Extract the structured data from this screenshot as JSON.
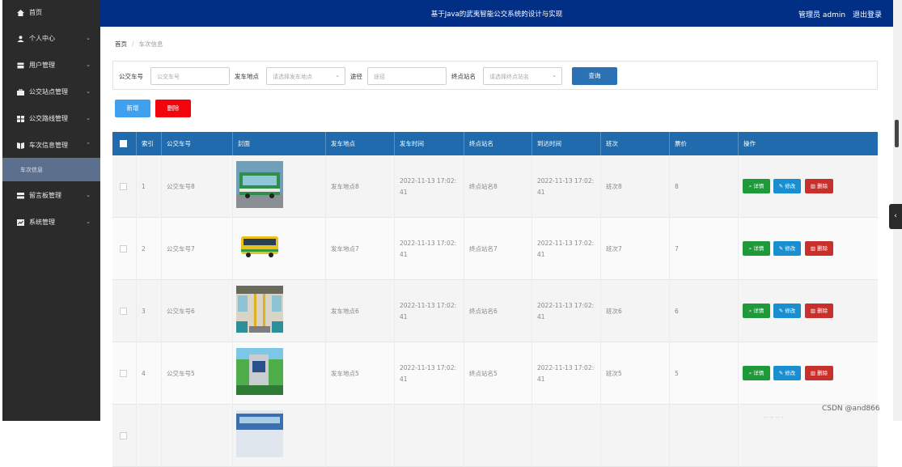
{
  "sidebar": {
    "items": [
      {
        "label": "首页",
        "icon": "home-icon",
        "has_chevron": false
      },
      {
        "label": "个人中心",
        "icon": "user-icon",
        "has_chevron": true,
        "chevron": "⌄"
      },
      {
        "label": "用户管理",
        "icon": "user-card-icon",
        "has_chevron": true,
        "chevron": "⌄"
      },
      {
        "label": "公交站点管理",
        "icon": "briefcase-icon",
        "has_chevron": true,
        "chevron": "⌄"
      },
      {
        "label": "公交路线管理",
        "icon": "grid-icon",
        "has_chevron": true,
        "chevron": "⌄"
      },
      {
        "label": "车次信息管理",
        "icon": "bookmark-icon",
        "has_chevron": true,
        "chevron": "⌃"
      },
      {
        "label": "留言板管理",
        "icon": "message-icon",
        "has_chevron": true,
        "chevron": "⌄"
      },
      {
        "label": "系统管理",
        "icon": "settings-icon",
        "has_chevron": true,
        "chevron": "⌄"
      }
    ],
    "active_sub": "车次信息"
  },
  "header": {
    "title": "基于Java的武夷智能公交系统的设计与实现",
    "user": "管理员 admin",
    "logout": "退出登录"
  },
  "breadcrumb": {
    "home": "首页",
    "current": "车次信息"
  },
  "search": {
    "fields": [
      {
        "label": "公交车号",
        "placeholder": "公交车号",
        "dropdown": false
      },
      {
        "label": "发车地点",
        "placeholder": "请选择发车地点",
        "dropdown": true
      },
      {
        "label": "途径",
        "placeholder": "途径",
        "dropdown": false
      },
      {
        "label": "终点站名",
        "placeholder": "请选择终点站名",
        "dropdown": true
      }
    ],
    "query_label": "查询"
  },
  "toolbar": {
    "add_label": "新增",
    "delete_label": "删除"
  },
  "table": {
    "headers": [
      "索引",
      "公交车号",
      "封面",
      "发车地点",
      "发车时间",
      "终点站名",
      "到达时间",
      "班次",
      "票价",
      "操作"
    ],
    "rows": [
      {
        "index": "1",
        "bus_no": "公交车号8",
        "cover": "green-bus-photo",
        "origin": "发车地点8",
        "depart_a": "2022-11-13 17:02:",
        "depart_b": "41",
        "terminal": "终点站名8",
        "arrive_a": "2022-11-13 17:02:",
        "arrive_b": "41",
        "shift": "班次8",
        "price": "8"
      },
      {
        "index": "2",
        "bus_no": "公交车号7",
        "cover": "yellow-bus-photo",
        "origin": "发车地点7",
        "depart_a": "2022-11-13 17:02:",
        "depart_b": "41",
        "terminal": "终点站名7",
        "arrive_a": "2022-11-13 17:02:",
        "arrive_b": "41",
        "shift": "班次7",
        "price": "7"
      },
      {
        "index": "3",
        "bus_no": "公交车号6",
        "cover": "bus-interior-photo",
        "origin": "发车地点6",
        "depart_a": "2022-11-13 17:02:",
        "depart_b": "41",
        "terminal": "终点站名6",
        "arrive_a": "2022-11-13 17:02:",
        "arrive_b": "41",
        "shift": "班次6",
        "price": "6"
      },
      {
        "index": "4",
        "bus_no": "公交车号5",
        "cover": "bus-charging-photo",
        "origin": "发车地点5",
        "depart_a": "2022-11-13 17:02:",
        "depart_b": "41",
        "terminal": "终点站名5",
        "arrive_a": "2022-11-13 17:02:",
        "arrive_b": "41",
        "shift": "班次5",
        "price": "5"
      },
      {
        "index": "",
        "bus_no": "",
        "cover": "blue-bus-photo",
        "origin": "",
        "depart_a": "",
        "depart_b": "",
        "terminal": "",
        "arrive_a": "",
        "arrive_b": "",
        "shift": "",
        "price": ""
      }
    ],
    "actions": {
      "detail": "详情",
      "edit": "修改",
      "delete": "删除"
    }
  },
  "watermark": "CSDN @and866",
  "colors": {
    "header_bg": "#012f86",
    "sidebar_bg": "#2b2b2b",
    "table_header": "#1f6bad",
    "detail_btn": "#1f9a3a",
    "edit_btn": "#1a8fd0",
    "delete_btn": "#c9302c",
    "add_btn": "#3fa0f0",
    "remove_btn": "#f2050d"
  }
}
